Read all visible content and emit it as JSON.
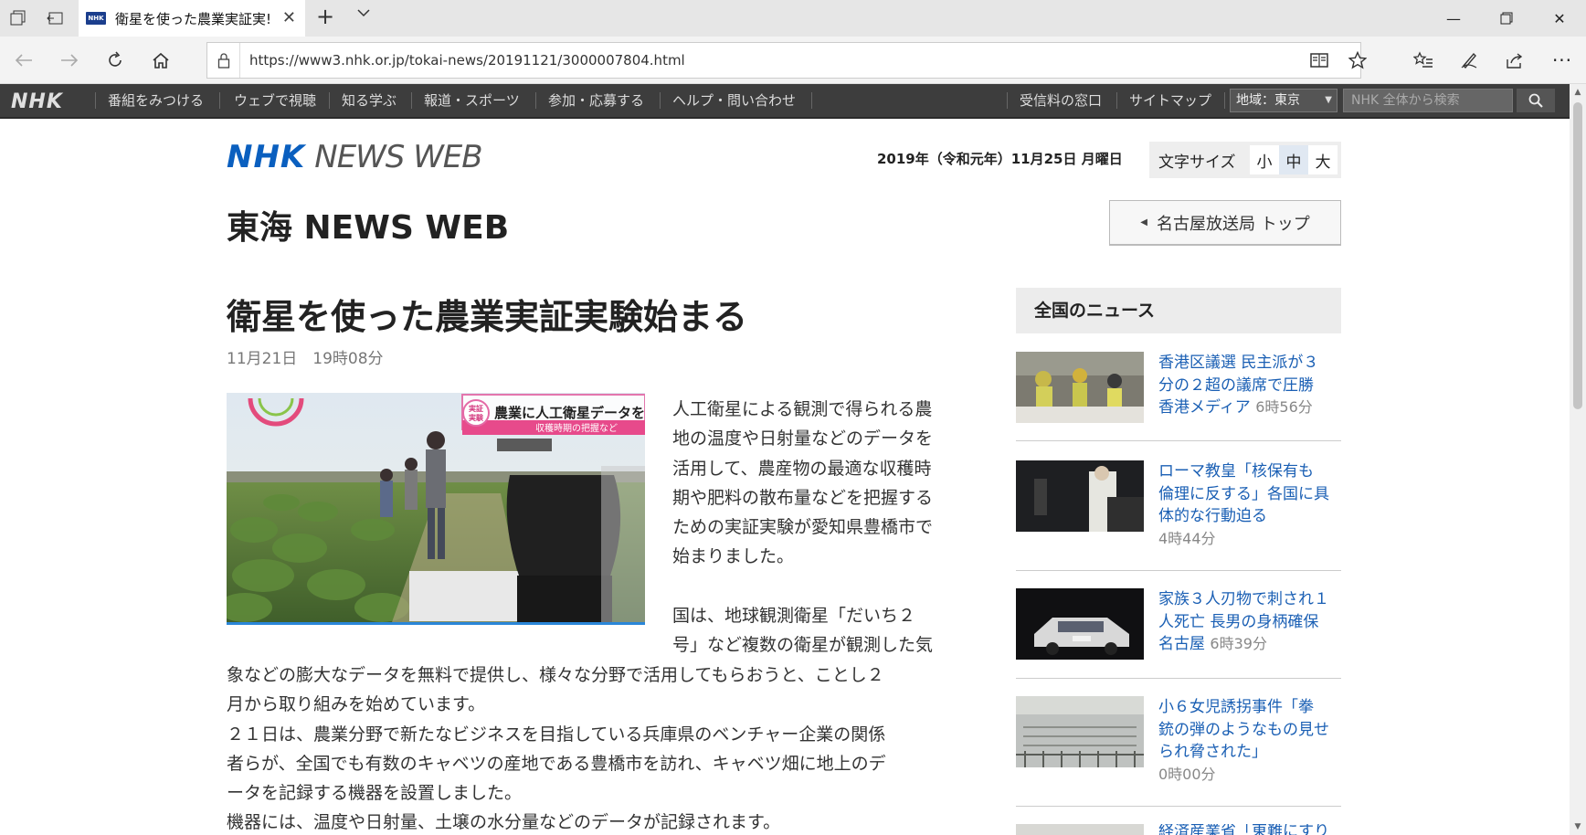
{
  "browser": {
    "tab_title": "衛星を使った農業実証実!",
    "favicon_text": "NHK",
    "url": "https://www3.nhk.or.jp/tokai-news/20191121/3000007804.html"
  },
  "gnav": {
    "logo": "NHK",
    "items": [
      "番組をみつける",
      "ウェブで視聴",
      "知る学ぶ",
      "報道・スポーツ",
      "参加・応募する",
      "ヘルプ・問い合わせ"
    ],
    "right_items": [
      "受信料の窓口",
      "サイトマップ"
    ],
    "region_label": "地域：東京",
    "search_placeholder": "NHK 全体から検索"
  },
  "header": {
    "logo_nhk": "NHK",
    "logo_newsweb": "NEWS WEB",
    "date": "2019年（令和元年）11月25日 月曜日",
    "fontsize_label": "文字サイズ",
    "fontsize_small": "小",
    "fontsize_medium": "中",
    "fontsize_large": "大",
    "region_title": "東海 NEWS WEB",
    "station_button": "名古屋放送局 トップ"
  },
  "article": {
    "headline": "衛星を使った農業実証実験始まる",
    "date": "11月21日　19時08分",
    "image_caption_badge": "実証実験",
    "image_caption_title": "農業に人工衛星データを",
    "image_caption_sub": "収穫時期の把握など",
    "para1_lines": [
      "人工衛星による観測で得られる農",
      "地の温度や日射量などのデータを",
      "活用して、農産物の最適な収穫時",
      "期や肥料の散布量などを把握する",
      "ための実証実験が愛知県豊橋市で",
      "始まりました。"
    ],
    "para2_lines_right": [
      "国は、地球観測衛星「だいち２",
      "号」など複数の衛星が観測した気"
    ],
    "para2_lines_full": [
      "象などの膨大なデータを無料で提供し、様々な分野で活用してもらおうと、ことし２",
      "月から取り組みを始めています。"
    ],
    "para3_lines": [
      "２１日は、農業分野で新たなビジネスを目指している兵庫県のベンチャー企業の関係",
      "者らが、全国でも有数のキャベツの産地である豊橋市を訪れ、キャベツ畑に地上のデ",
      "ータを記録する機器を設置しました。"
    ],
    "para4_lines": [
      "機器には、温度や日射量、土壌の水分量などのデータが記録されます。"
    ]
  },
  "sidebar": {
    "title": "全国のニュース",
    "items": [
      {
        "lines": [
          "香港区議選 民主派が３",
          "分の２超の議席で圧勝",
          "香港メディア "
        ],
        "time": "6時56分"
      },
      {
        "lines": [
          "ローマ教皇「核保有も",
          "倫理に反する」各国に具",
          "体的な行動迫る"
        ],
        "time": "4時44分"
      },
      {
        "lines": [
          "家族３人刃物で刺され１",
          "人死亡 長男の身柄確保",
          "名古屋 "
        ],
        "time": "6時39分"
      },
      {
        "lines": [
          "小６女児誘拐事件「拳",
          "銃の弾のようなもの見せ",
          "られ脅された」"
        ],
        "time": "0時00分"
      },
      {
        "lines": [
          "経済産業省「東難にすり"
        ],
        "time": ""
      }
    ]
  }
}
